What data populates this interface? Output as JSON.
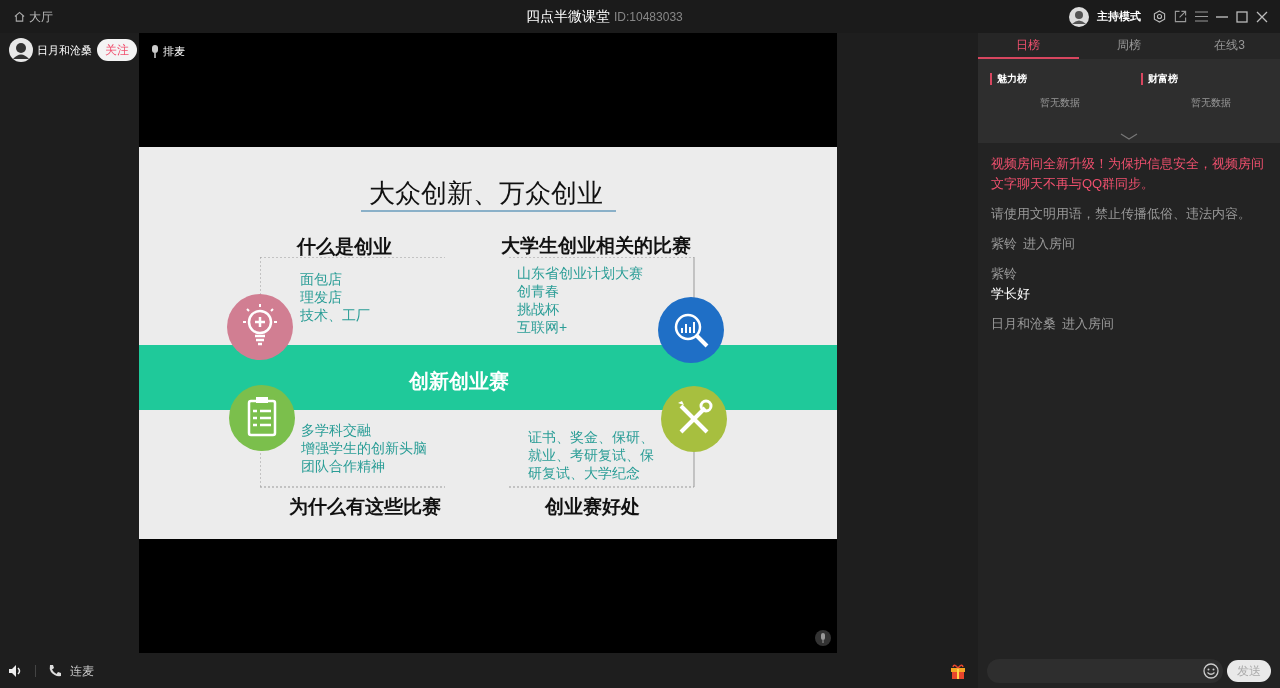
{
  "window": {
    "home_label": "大厅",
    "title": "四点半微课堂",
    "room_id": "ID:10483033",
    "mode": "主持模式"
  },
  "host": {
    "name": "日月和沧桑",
    "follow_label": "关注",
    "queue_label": "排麦"
  },
  "slide": {
    "title": "大众创新、万众创业",
    "banner": "创新创业赛",
    "quadrants": [
      {
        "kind": "idea",
        "heading": "什么是创业",
        "items": [
          "面包店",
          "理发店",
          "技术、工厂"
        ]
      },
      {
        "kind": "search",
        "heading": "大学生创业相关的比赛",
        "items": [
          "山东省创业计划大赛",
          "创青春",
          "挑战杯",
          "互联网+"
        ]
      },
      {
        "kind": "clipboard",
        "heading": "为什么有这些比赛",
        "items": [
          "多学科交融",
          "增强学生的创新头脑",
          "团队合作精神"
        ]
      },
      {
        "kind": "tools",
        "heading": "创业赛好处",
        "items": [
          "证书、奖金、保研、",
          "就业、考研复试、保",
          "研复试、大学纪念"
        ]
      }
    ]
  },
  "right_panel": {
    "tabs": [
      {
        "label": "日榜",
        "selected": true
      },
      {
        "label": "周榜",
        "selected": false
      },
      {
        "label": "在线3",
        "selected": false
      }
    ],
    "boards": [
      {
        "title": "魅力榜",
        "empty_text": "暂无数据"
      },
      {
        "title": "财富榜",
        "empty_text": "暂无数据"
      }
    ]
  },
  "chat": [
    {
      "kind": "notice",
      "text": "视频房间全新升级！为保护信息安全，视频房间文字聊天不再与QQ群同步。"
    },
    {
      "kind": "system",
      "text": "请使用文明用语，禁止传播低俗、违法内容。"
    },
    {
      "kind": "enter",
      "user": "紫铃",
      "text": "进入房间"
    },
    {
      "kind": "message",
      "user": "紫铃",
      "text": "学长好"
    },
    {
      "kind": "enter",
      "user": "日月和沧桑",
      "text": "进入房间"
    }
  ],
  "bottom": {
    "call_label": "连麦",
    "send_label": "发送"
  }
}
